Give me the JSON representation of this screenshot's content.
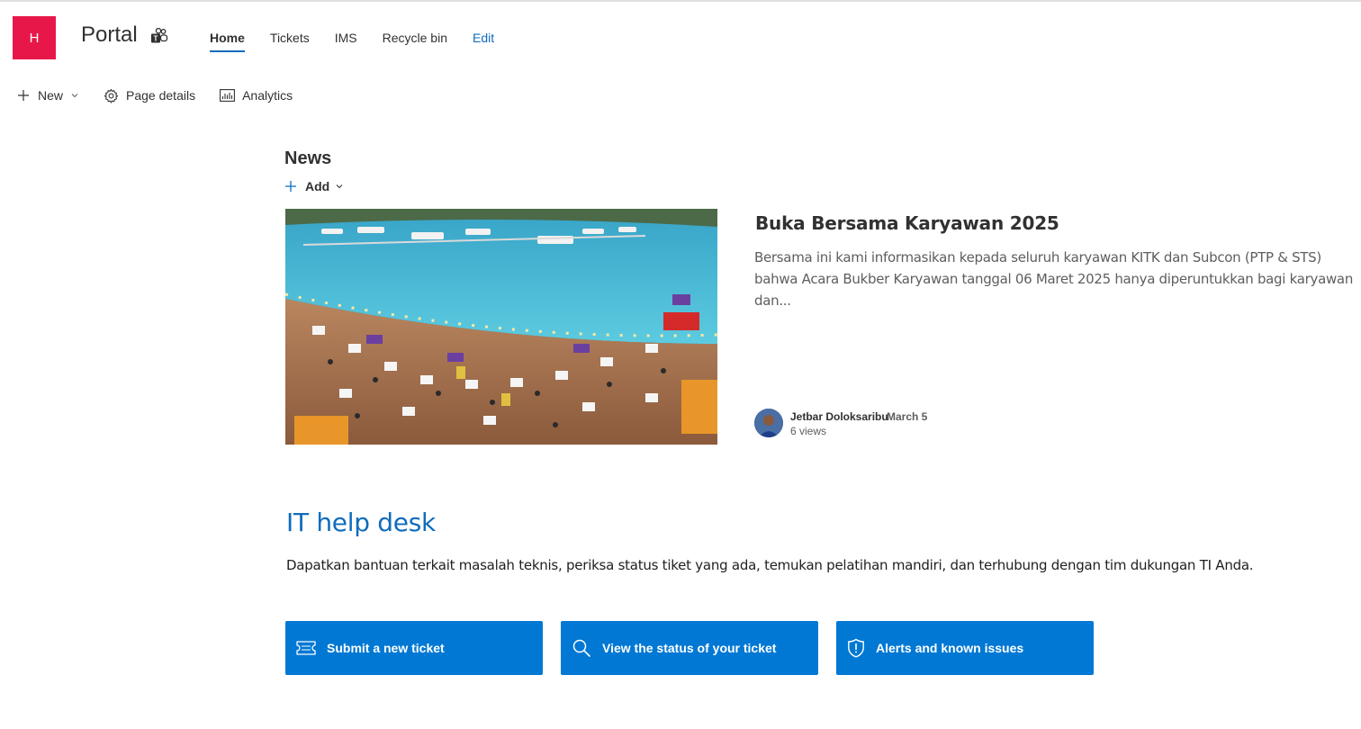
{
  "site": {
    "logo_letter": "H",
    "title": "Portal",
    "logo_color": "#e8174a"
  },
  "nav": {
    "items": [
      {
        "label": "Home",
        "active": true
      },
      {
        "label": "Tickets"
      },
      {
        "label": "IMS"
      },
      {
        "label": "Recycle bin"
      },
      {
        "label": "Edit"
      }
    ]
  },
  "commandbar": {
    "new_label": "New",
    "page_details_label": "Page details",
    "analytics_label": "Analytics"
  },
  "news": {
    "heading": "News",
    "add_label": "Add",
    "article": {
      "title": "Buka Bersama Karyawan 2025",
      "description": "Bersama ini kami informasikan kepada seluruh karyawan KITK dan Subcon (PTP & STS) bahwa Acara Bukber Karyawan tanggal 06 Maret 2025 hanya diperuntukkan bagi karyawan dan...",
      "author": "Jetbar Doloksaribu",
      "date": "March 5",
      "views": "6 views"
    }
  },
  "helpdesk": {
    "title": "IT help desk",
    "description": "Dapatkan bantuan terkait masalah teknis, periksa status tiket yang ada, temukan pelatihan mandiri, dan terhubung dengan tim dukungan TI Anda.",
    "buttons": [
      {
        "label": "Submit a new ticket",
        "icon": "ticket-icon"
      },
      {
        "label": "View the status of your ticket",
        "icon": "search-icon"
      },
      {
        "label": "Alerts and known issues",
        "icon": "shield-alert-icon"
      }
    ],
    "accent": "#0078d4"
  }
}
